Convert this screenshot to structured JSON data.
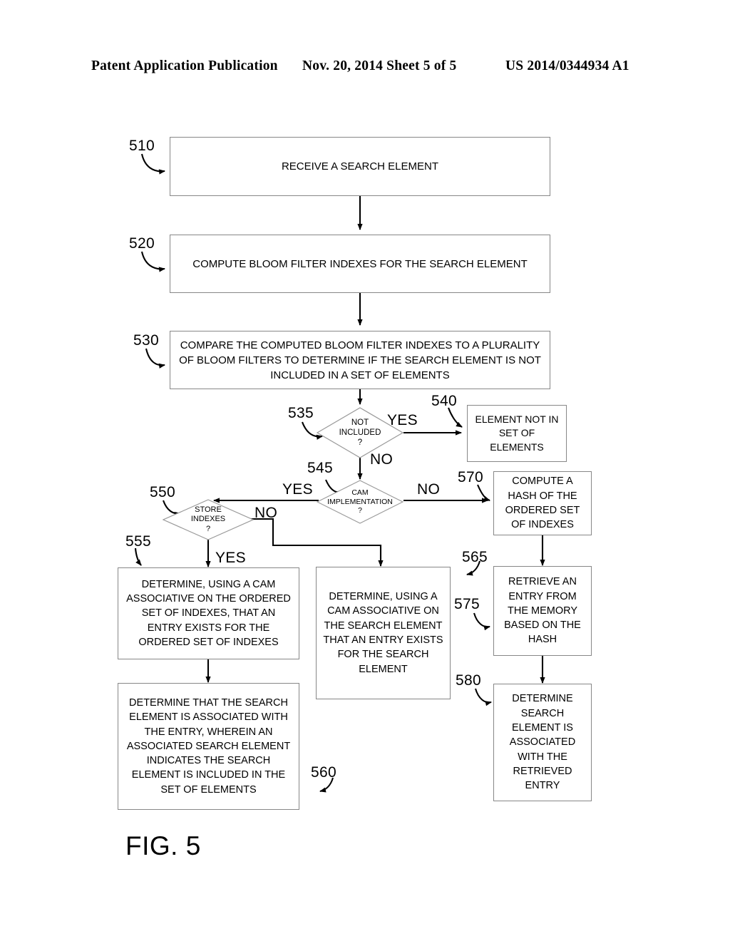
{
  "header": {
    "left": "Patent Application Publication",
    "middle": "Nov. 20, 2014  Sheet 5 of 5",
    "right": "US 2014/0344934 A1"
  },
  "figure": {
    "caption": "FIG. 5"
  },
  "colors": {
    "box_stroke": "#878787",
    "line": "#000000",
    "text": "#000000",
    "background": "#ffffff"
  },
  "flowchart": {
    "type": "flowchart",
    "boxes": [
      {
        "ref": "510",
        "kind": "process",
        "text": "RECEIVE A SEARCH ELEMENT"
      },
      {
        "ref": "520",
        "kind": "process",
        "text": "COMPUTE BLOOM FILTER INDEXES FOR THE SEARCH ELEMENT"
      },
      {
        "ref": "530",
        "kind": "process",
        "text": "COMPARE THE COMPUTED BLOOM FILTER INDEXES TO A PLURALITY OF BLOOM FILTERS TO DETERMINE IF THE SEARCH ELEMENT IS NOT INCLUDED IN A SET OF ELEMENTS"
      },
      {
        "ref": "535",
        "kind": "decision",
        "line1": "NOT",
        "line2": "INCLUDED",
        "line3": "?"
      },
      {
        "ref": "540",
        "kind": "process",
        "text": "ELEMENT NOT IN SET OF ELEMENTS"
      },
      {
        "ref": "545",
        "kind": "decision",
        "line1": "CAM",
        "line2": "IMPLEMENTATION",
        "line3": "?"
      },
      {
        "ref": "550",
        "kind": "decision",
        "line1": "STORE",
        "line2": "INDEXES",
        "line3": "?"
      },
      {
        "ref": "555",
        "kind": "process",
        "text": "DETERMINE, USING A CAM ASSOCIATIVE ON THE ORDERED SET OF INDEXES, THAT AN ENTRY EXISTS FOR THE ORDERED SET OF INDEXES"
      },
      {
        "ref": "560",
        "kind": "process",
        "text": "DETERMINE THAT THE SEARCH ELEMENT IS ASSOCIATED WITH THE ENTRY, WHEREIN AN ASSOCIATED SEARCH ELEMENT INDICATES THE SEARCH ELEMENT IS INCLUDED IN THE SET OF ELEMENTS"
      },
      {
        "ref": "565",
        "kind": "process",
        "text": "DETERMINE, USING A CAM ASSOCIATIVE ON THE SEARCH ELEMENT THAT AN ENTRY EXISTS FOR THE SEARCH ELEMENT"
      },
      {
        "ref": "570",
        "kind": "process",
        "text": "COMPUTE A HASH OF THE ORDERED SET OF INDEXES"
      },
      {
        "ref": "575",
        "kind": "process",
        "text": "RETRIEVE AN ENTRY FROM THE MEMORY BASED ON THE HASH"
      },
      {
        "ref": "580",
        "kind": "process",
        "text": "DETERMINE SEARCH ELEMENT IS ASSOCIATED WITH THE RETRIEVED ENTRY"
      }
    ],
    "branch_labels": {
      "not_included_yes": "YES",
      "not_included_no": "NO",
      "cam_impl_yes": "YES",
      "cam_impl_no": "NO",
      "store_indexes_yes": "YES",
      "store_indexes_no": "NO"
    }
  }
}
